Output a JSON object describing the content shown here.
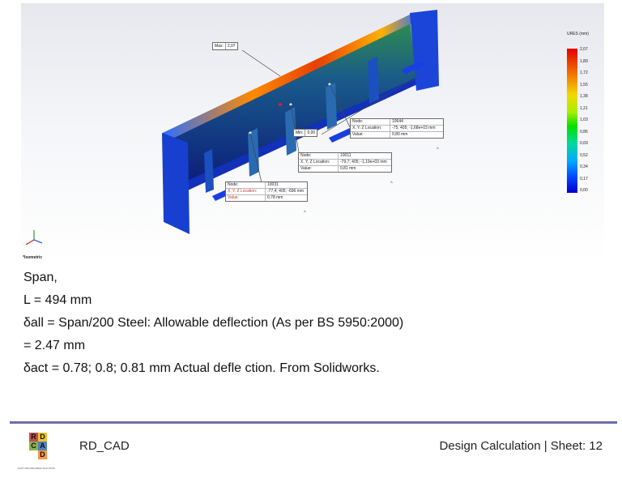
{
  "viewport": {
    "max_tag": {
      "label": "Max:",
      "value": "2,07"
    },
    "min_tag": {
      "label": "Min:",
      "value": "0,00"
    },
    "probes": [
      {
        "rows": [
          {
            "key": "Node:",
            "value": "10644"
          },
          {
            "key": "X, Y, Z Location:",
            "value": "-75; 405; -1,68e+03 mm"
          },
          {
            "key": "Value:",
            "value": "0,80 mm"
          }
        ]
      },
      {
        "rows": [
          {
            "key": "Node:",
            "value": "10011"
          },
          {
            "key": "X, Y, Z Location:",
            "value": "-79,7; 405; -1,19e+03 mm"
          },
          {
            "key": "Value:",
            "value": "0,81 mm"
          }
        ]
      },
      {
        "rows": [
          {
            "key": "Node:",
            "value": "10031"
          },
          {
            "key": "X, Y, Z Location:",
            "value": "-77,4; 405; -696 mm"
          },
          {
            "key": "Value:",
            "value": "0,78 mm"
          }
        ]
      }
    ],
    "legend": {
      "title": "URES (mm)",
      "labels": [
        "2,07",
        "1,89",
        "1,72",
        "1,55",
        "1,38",
        "1,21",
        "1,03",
        "0,86",
        "0,69",
        "0,52",
        "0,34",
        "0,17",
        "0,00"
      ]
    },
    "view_name": "*Isometric"
  },
  "text": {
    "line1": "Span,",
    "line2": "L = 494 mm",
    "line3": "δall = Span/200 Steel: Allowable deflection (As per BS 5950:2000)",
    "line4": "= 2.47 mm",
    "line5": "δact = 0.78; 0.8; 0.81 mm Actual defle ction. From Solidworks."
  },
  "footer": {
    "logo_letters": {
      "r": "R",
      "d1": "D",
      "c": "C",
      "a": "A",
      "d2": "D"
    },
    "logo_tagline": "FAST AND RELIABLE SOLUTION",
    "left": "RD_CAD",
    "right": "Design Calculation | Sheet: 12"
  },
  "colors": {
    "rule": "#6a6fa8",
    "logo_r": "#c0504d",
    "logo_d": "#f2c12e",
    "logo_c": "#8db04f",
    "logo_a": "#4f81bd",
    "logo_d2": "#f79646"
  }
}
